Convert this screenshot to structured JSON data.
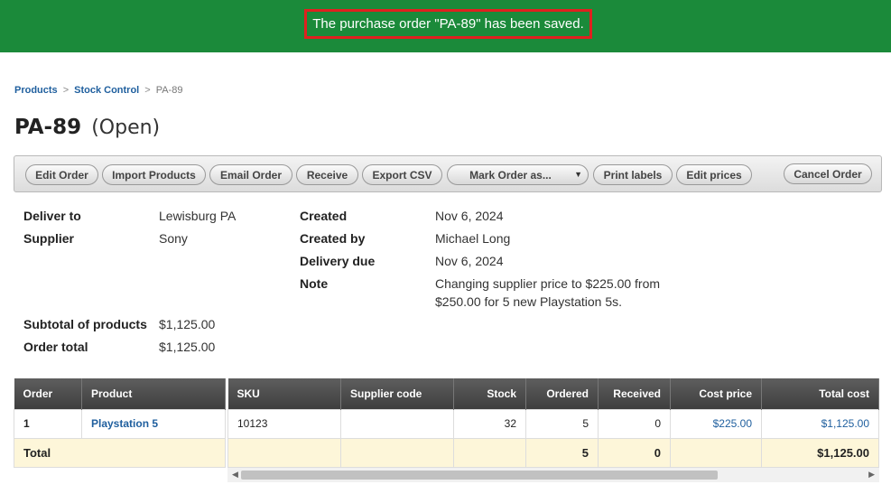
{
  "banner": {
    "message": "The purchase order \"PA-89\" has been saved."
  },
  "breadcrumb": {
    "items": [
      "Products",
      "Stock Control"
    ],
    "separator": ">",
    "current": "PA-89"
  },
  "title": {
    "code": "PA-89",
    "status": "(Open)"
  },
  "toolbar": {
    "edit_order": "Edit Order",
    "import_products": "Import Products",
    "email_order": "Email Order",
    "receive": "Receive",
    "export_csv": "Export CSV",
    "mark_order_as": "Mark Order as...",
    "print_labels": "Print labels",
    "edit_prices": "Edit prices",
    "cancel_order": "Cancel Order"
  },
  "details": {
    "deliver_to_label": "Deliver to",
    "deliver_to": "Lewisburg PA",
    "supplier_label": "Supplier",
    "supplier": "Sony",
    "created_label": "Created",
    "created": "Nov 6, 2024",
    "created_by_label": "Created by",
    "created_by": "Michael Long",
    "delivery_due_label": "Delivery due",
    "delivery_due": "Nov 6, 2024",
    "note_label": "Note",
    "note": "Changing supplier price to $225.00 from $250.00 for 5 new Playstation 5s.",
    "subtotal_label": "Subtotal of products",
    "subtotal": "$1,125.00",
    "order_total_label": "Order total",
    "order_total": "$1,125.00"
  },
  "table": {
    "columns": {
      "order": "Order",
      "product": "Product",
      "sku": "SKU",
      "supplier_code": "Supplier code",
      "stock": "Stock",
      "ordered": "Ordered",
      "received": "Received",
      "cost_price": "Cost price",
      "total_cost": "Total cost"
    },
    "rows": [
      {
        "order": "1",
        "product": "Playstation 5",
        "sku": "10123",
        "supplier_code": "",
        "stock": "32",
        "ordered": "5",
        "received": "0",
        "cost_price": "$225.00",
        "total_cost": "$1,125.00"
      }
    ],
    "total": {
      "label": "Total",
      "ordered": "5",
      "received": "0",
      "total_cost": "$1,125.00"
    }
  },
  "colors": {
    "banner": "#1b8a3a",
    "highlight_border": "#e0201f",
    "link": "#1f5f9e",
    "total_row": "#fdf6d9"
  }
}
